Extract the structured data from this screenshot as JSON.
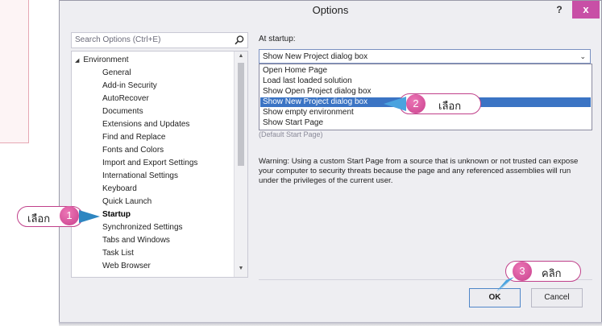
{
  "dialog": {
    "title": "Options",
    "help_label": "?",
    "close_label": "x"
  },
  "search": {
    "placeholder": "Search Options (Ctrl+E)"
  },
  "tree": {
    "root_label": "Environment",
    "items": [
      "General",
      "Add-in Security",
      "AutoRecover",
      "Documents",
      "Extensions and Updates",
      "Find and Replace",
      "Fonts and Colors",
      "Import and Export Settings",
      "International Settings",
      "Keyboard",
      "Quick Launch",
      "Startup",
      "Synchronized Settings",
      "Tabs and Windows",
      "Task List",
      "Web Browser"
    ],
    "selected_item": "Startup"
  },
  "startup": {
    "label": "At startup:",
    "selected_value": "Show New Project dialog box",
    "options": [
      "Open Home Page",
      "Load last loaded solution",
      "Show Open Project dialog box",
      "Show New Project dialog box",
      "Show empty environment",
      "Show Start Page"
    ],
    "under_text": "(Default Start Page)"
  },
  "warning": "Warning: Using a custom Start Page from a source that is unknown or not trusted can expose your computer to security threats because the page and any referenced assemblies will run under the privileges of the current user.",
  "buttons": {
    "ok": "OK",
    "cancel": "Cancel"
  },
  "callouts": [
    {
      "number": "1",
      "text": "เลือก"
    },
    {
      "number": "2",
      "text": "เลือก"
    },
    {
      "number": "3",
      "text": "คลิก"
    }
  ],
  "colors": {
    "accent_pink": "#c9418d",
    "selection_blue": "#3b74c4",
    "close_button": "#c84fa6"
  }
}
